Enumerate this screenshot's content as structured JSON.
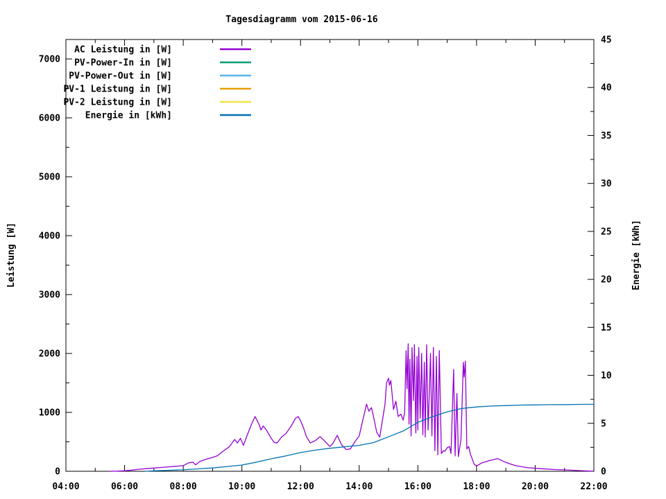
{
  "title": "Tagesdiagramm vom 2015-06-16",
  "chart_data": {
    "type": "line",
    "title": "Tagesdiagramm vom 2015-06-16",
    "grid": false,
    "legend_position": "top-left-inside",
    "x_axis": {
      "range_hours": [
        4,
        22
      ],
      "minor_step_hours": 1,
      "major_step_hours": 2,
      "tick_labels": [
        "04:00",
        "06:00",
        "08:00",
        "10:00",
        "12:00",
        "14:00",
        "16:00",
        "18:00",
        "20:00",
        "22:00"
      ]
    },
    "y_axis": {
      "label": "Leistung [W]",
      "range": [
        0,
        7330
      ],
      "major_step": 1000,
      "minor_step": 500,
      "tick_labels": [
        "0",
        "1000",
        "2000",
        "3000",
        "4000",
        "5000",
        "6000",
        "7000"
      ]
    },
    "y2_axis": {
      "label": "Energie [kWh]",
      "range": [
        0,
        45
      ],
      "major_step": 5,
      "minor_step": 2.5,
      "tick_labels": [
        "0",
        "5",
        "10",
        "15",
        "20",
        "25",
        "30",
        "35",
        "40",
        "45"
      ]
    },
    "series": [
      {
        "name": "AC Leistung in [W]",
        "color": "#9400d3",
        "axis": "y1",
        "points": [
          [
            5.5,
            0
          ],
          [
            5.75,
            2
          ],
          [
            6.0,
            8
          ],
          [
            6.25,
            20
          ],
          [
            6.5,
            35
          ],
          [
            6.75,
            45
          ],
          [
            7.0,
            55
          ],
          [
            7.25,
            65
          ],
          [
            7.5,
            75
          ],
          [
            7.75,
            85
          ],
          [
            8.0,
            95
          ],
          [
            8.17,
            140
          ],
          [
            8.33,
            155
          ],
          [
            8.42,
            110
          ],
          [
            8.58,
            170
          ],
          [
            8.75,
            200
          ],
          [
            9.0,
            235
          ],
          [
            9.17,
            265
          ],
          [
            9.33,
            330
          ],
          [
            9.58,
            420
          ],
          [
            9.75,
            540
          ],
          [
            9.85,
            480
          ],
          [
            9.95,
            560
          ],
          [
            10.05,
            440
          ],
          [
            10.17,
            600
          ],
          [
            10.33,
            800
          ],
          [
            10.45,
            930
          ],
          [
            10.53,
            850
          ],
          [
            10.6,
            780
          ],
          [
            10.65,
            700
          ],
          [
            10.73,
            770
          ],
          [
            10.85,
            690
          ],
          [
            11.0,
            560
          ],
          [
            11.1,
            490
          ],
          [
            11.2,
            480
          ],
          [
            11.35,
            580
          ],
          [
            11.5,
            640
          ],
          [
            11.67,
            760
          ],
          [
            11.83,
            900
          ],
          [
            11.92,
            930
          ],
          [
            12.0,
            860
          ],
          [
            12.1,
            740
          ],
          [
            12.2,
            590
          ],
          [
            12.33,
            480
          ],
          [
            12.5,
            520
          ],
          [
            12.67,
            590
          ],
          [
            12.83,
            510
          ],
          [
            13.0,
            420
          ],
          [
            13.1,
            470
          ],
          [
            13.25,
            610
          ],
          [
            13.4,
            450
          ],
          [
            13.55,
            370
          ],
          [
            13.7,
            380
          ],
          [
            13.85,
            500
          ],
          [
            14.0,
            600
          ],
          [
            14.08,
            780
          ],
          [
            14.17,
            970
          ],
          [
            14.25,
            1140
          ],
          [
            14.33,
            1020
          ],
          [
            14.42,
            1080
          ],
          [
            14.5,
            900
          ],
          [
            14.6,
            660
          ],
          [
            14.7,
            580
          ],
          [
            14.8,
            890
          ],
          [
            14.88,
            1140
          ],
          [
            14.93,
            1500
          ],
          [
            15.0,
            1580
          ],
          [
            15.03,
            1460
          ],
          [
            15.08,
            1540
          ],
          [
            15.17,
            1050
          ],
          [
            15.25,
            1190
          ],
          [
            15.33,
            930
          ],
          [
            15.42,
            970
          ],
          [
            15.5,
            870
          ],
          [
            15.55,
            1000
          ],
          [
            15.58,
            1670
          ],
          [
            15.6,
            2050
          ],
          [
            15.63,
            1400
          ],
          [
            15.67,
            2165
          ],
          [
            15.7,
            800
          ],
          [
            15.73,
            1900
          ],
          [
            15.77,
            600
          ],
          [
            15.8,
            2100
          ],
          [
            15.85,
            1200
          ],
          [
            15.88,
            2150
          ],
          [
            15.93,
            650
          ],
          [
            15.97,
            1950
          ],
          [
            16.0,
            700
          ],
          [
            16.03,
            2100
          ],
          [
            16.08,
            900
          ],
          [
            16.13,
            2000
          ],
          [
            16.17,
            620
          ],
          [
            16.22,
            1850
          ],
          [
            16.25,
            580
          ],
          [
            16.3,
            2150
          ],
          [
            16.35,
            700
          ],
          [
            16.4,
            1450
          ],
          [
            16.43,
            2000
          ],
          [
            16.48,
            600
          ],
          [
            16.53,
            2100
          ],
          [
            16.58,
            350
          ],
          [
            16.63,
            1950
          ],
          [
            16.68,
            280
          ],
          [
            16.73,
            2050
          ],
          [
            16.8,
            300
          ],
          [
            16.87,
            350
          ],
          [
            16.92,
            340
          ],
          [
            17.0,
            400
          ],
          [
            17.08,
            420
          ],
          [
            17.13,
            300
          ],
          [
            17.22,
            1730
          ],
          [
            17.27,
            260
          ],
          [
            17.33,
            1320
          ],
          [
            17.38,
            250
          ],
          [
            17.47,
            550
          ],
          [
            17.55,
            1850
          ],
          [
            17.58,
            1600
          ],
          [
            17.62,
            1870
          ],
          [
            17.67,
            380
          ],
          [
            17.73,
            420
          ],
          [
            17.8,
            280
          ],
          [
            17.92,
            120
          ],
          [
            18.0,
            90
          ],
          [
            18.17,
            140
          ],
          [
            18.42,
            180
          ],
          [
            18.72,
            215
          ],
          [
            19.0,
            150
          ],
          [
            19.33,
            95
          ],
          [
            19.75,
            60
          ],
          [
            20.17,
            45
          ],
          [
            20.67,
            30
          ],
          [
            21.08,
            22
          ],
          [
            21.5,
            12
          ],
          [
            21.83,
            5
          ],
          [
            21.97,
            2
          ]
        ]
      },
      {
        "name": "PV-Power-In in [W]",
        "color": "#009e73",
        "axis": "y1",
        "points": []
      },
      {
        "name": "PV-Power-Out in [W]",
        "color": "#56b4e9",
        "axis": "y1",
        "points": []
      },
      {
        "name": "PV-1 Leistung in [W]",
        "color": "#e69f00",
        "axis": "y1",
        "points": []
      },
      {
        "name": "PV-2 Leistung in [W]",
        "color": "#f0e442",
        "axis": "y1",
        "points": []
      },
      {
        "name": "Energie in [kWh]",
        "color": "#0072b2",
        "axis": "y2",
        "points": [
          [
            6.7,
            0
          ],
          [
            7.0,
            0.05
          ],
          [
            7.5,
            0.1
          ],
          [
            8.0,
            0.15
          ],
          [
            8.5,
            0.25
          ],
          [
            9.0,
            0.35
          ],
          [
            9.5,
            0.5
          ],
          [
            10.0,
            0.65
          ],
          [
            10.5,
            0.95
          ],
          [
            11.0,
            1.3
          ],
          [
            11.5,
            1.6
          ],
          [
            12.0,
            1.95
          ],
          [
            12.5,
            2.2
          ],
          [
            13.0,
            2.4
          ],
          [
            13.5,
            2.55
          ],
          [
            14.0,
            2.7
          ],
          [
            14.5,
            3.0
          ],
          [
            15.0,
            3.6
          ],
          [
            15.5,
            4.2
          ],
          [
            16.0,
            5.1
          ],
          [
            16.5,
            5.7
          ],
          [
            17.0,
            6.2
          ],
          [
            17.5,
            6.55
          ],
          [
            18.0,
            6.7
          ],
          [
            18.5,
            6.8
          ],
          [
            19.0,
            6.85
          ],
          [
            19.5,
            6.9
          ],
          [
            20.0,
            6.92
          ],
          [
            20.5,
            6.94
          ],
          [
            21.0,
            6.95
          ],
          [
            21.5,
            6.97
          ],
          [
            22.0,
            6.98
          ]
        ]
      }
    ]
  }
}
